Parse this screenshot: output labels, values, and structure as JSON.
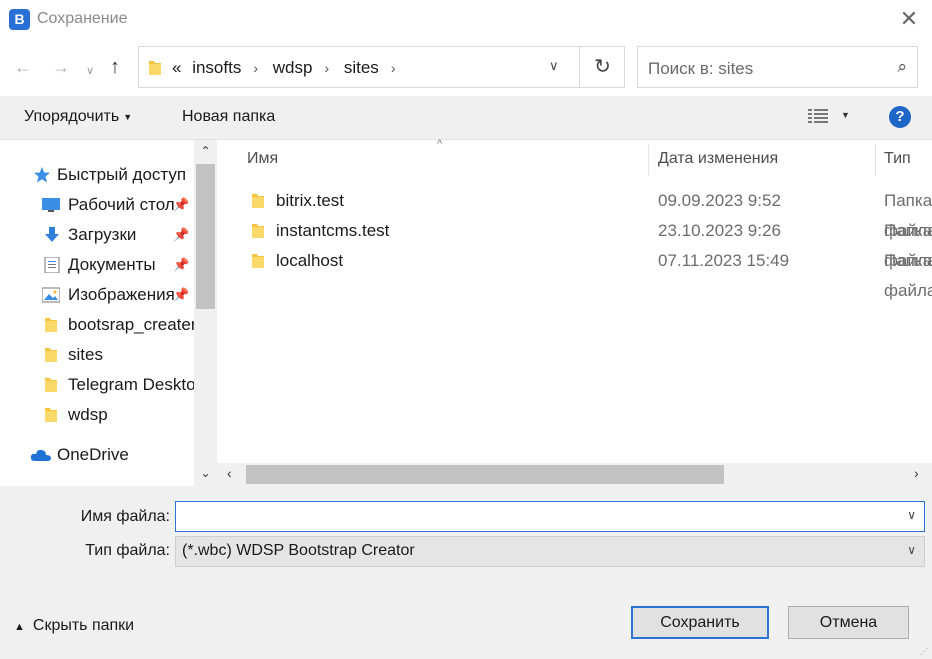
{
  "window": {
    "title": "Сохранение",
    "app_icon_letter": "B",
    "accent": "#2b74d6"
  },
  "nav": {
    "back_icon": "←",
    "forward_icon": "→",
    "recent_icon": "∨",
    "up_icon": "↑",
    "breadcrumb_prefix": "«",
    "breadcrumbs": [
      "insofts",
      "wdsp",
      "sites"
    ],
    "crumb_separator": "›",
    "dropdown_icon": "∨",
    "refresh_icon": "↻"
  },
  "search": {
    "placeholder": "Поиск в: sites"
  },
  "toolbar": {
    "organize_label": "Упорядочить",
    "new_folder_label": "Новая папка",
    "help_label": "?"
  },
  "sidebar": {
    "items": [
      {
        "label": "Быстрый доступ",
        "icon": "star-icon",
        "indent": 0,
        "pinned": false
      },
      {
        "label": "Рабочий стол",
        "icon": "desktop-icon",
        "indent": 1,
        "pinned": true
      },
      {
        "label": "Загрузки",
        "icon": "download-icon",
        "indent": 1,
        "pinned": true
      },
      {
        "label": "Документы",
        "icon": "documents-icon",
        "indent": 1,
        "pinned": true
      },
      {
        "label": "Изображения",
        "icon": "pictures-icon",
        "indent": 1,
        "pinned": true
      },
      {
        "label": "bootsrap_creater",
        "icon": "folder-icon",
        "indent": 1,
        "pinned": false
      },
      {
        "label": "sites",
        "icon": "folder-icon",
        "indent": 1,
        "pinned": false
      },
      {
        "label": "Telegram Desktop",
        "icon": "folder-icon",
        "indent": 1,
        "pinned": false
      },
      {
        "label": "wdsp",
        "icon": "folder-icon",
        "indent": 1,
        "pinned": false
      }
    ],
    "onedrive_label": "OneDrive"
  },
  "files": {
    "columns": {
      "name": "Имя",
      "date": "Дата изменения",
      "type": "Тип"
    },
    "rows": [
      {
        "name": "bitrix.test",
        "date": "09.09.2023 9:52",
        "type": "Папка с файлами"
      },
      {
        "name": "instantcms.test",
        "date": "23.10.2023 9:26",
        "type": "Папка с файлами"
      },
      {
        "name": "localhost",
        "date": "07.11.2023 15:49",
        "type": "Папка с файлами"
      }
    ]
  },
  "form": {
    "filename_label": "Имя файла:",
    "filename_value": "",
    "filetype_label": "Тип файла:",
    "filetype_value": "(*.wbc) WDSP Bootstrap Creator"
  },
  "footer": {
    "hide_folders_label": "Скрыть папки",
    "save_label": "Сохранить",
    "cancel_label": "Отмена"
  }
}
